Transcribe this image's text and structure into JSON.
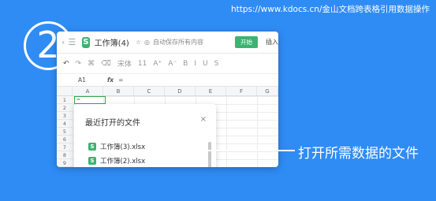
{
  "source_url": "https://www.kdocs.cn/金山文档跨表格引用数据操作",
  "step_number": "2",
  "window": {
    "doc_title": "工作簿(4)",
    "autosave_text": "自动保存所有内容",
    "start_button": "开始",
    "insert_tab": "插入",
    "logo_letter": "S"
  },
  "toolbar": {
    "font_name": "宋体",
    "font_size": "11",
    "grow": "A⁺",
    "shrink": "A⁻",
    "bold": "B",
    "italic": "I",
    "underline": "U",
    "strike": "S"
  },
  "formula_bar": {
    "cell_ref": "A1",
    "fx_label": "fx",
    "content": "="
  },
  "grid": {
    "columns": [
      "A",
      "B",
      "C",
      "D",
      "E",
      "F",
      "G"
    ],
    "rows": [
      "1",
      "2",
      "3",
      "4",
      "5",
      "6",
      "7",
      "8",
      "9"
    ],
    "active_cell_value": "="
  },
  "recent_panel": {
    "title": "最近打开的文件",
    "close": "×",
    "files": [
      {
        "name": "工作簿(3).xlsx",
        "icon_letter": "S"
      },
      {
        "name": "工作簿(2).xlsx",
        "icon_letter": "S"
      }
    ]
  },
  "callout_text": "打开所需数据的文件",
  "colors": {
    "background": "#2f8cf5",
    "brand_green": "#3cb371",
    "active_cell_border": "#2fa84f"
  }
}
